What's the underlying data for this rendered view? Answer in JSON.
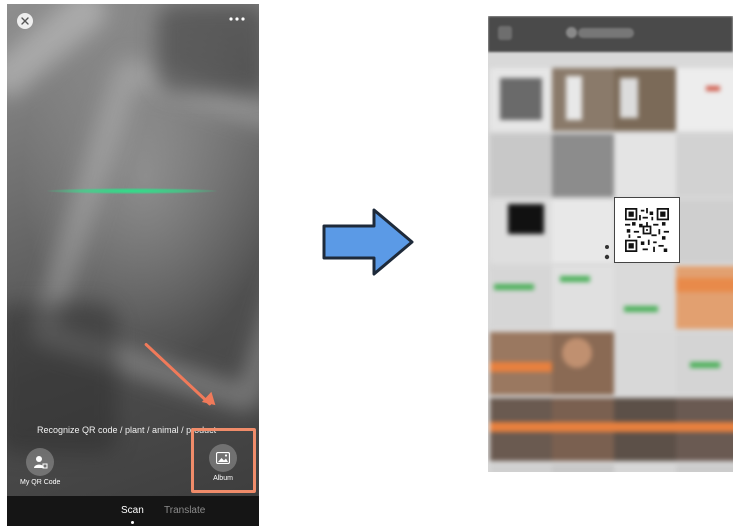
{
  "scanner": {
    "hint": "Recognize QR code / plant / animal / product",
    "my_qr_label": "My QR Code",
    "album_label": "Album",
    "tabs": [
      {
        "label": "Scan",
        "active": true
      },
      {
        "label": "Translate",
        "active": false
      }
    ],
    "icons": {
      "close": "close-icon",
      "more": "more-icon",
      "my_qr": "person-qr-icon",
      "album": "image-icon"
    },
    "colors": {
      "scan_line": "#2fe08a",
      "annotation": "#f07a5a"
    }
  },
  "transition": {
    "icon": "right-arrow-icon",
    "color": "#5b9ae6"
  },
  "album_view": {
    "icons": {
      "back": "back-icon",
      "app_logo": "app-logo-icon"
    },
    "selected_item": "qr-code-image"
  }
}
